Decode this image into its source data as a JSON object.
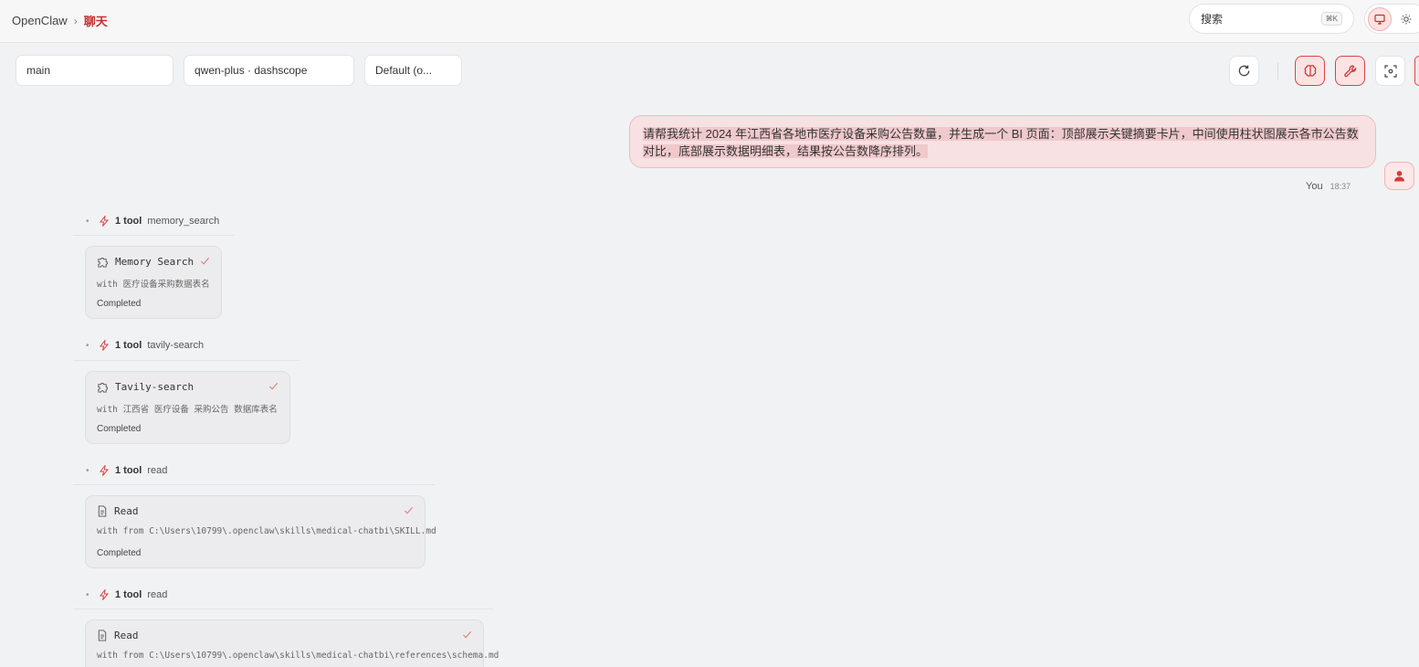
{
  "breadcrumb": {
    "app": "OpenClaw",
    "separator": "›",
    "current": "聊天"
  },
  "search": {
    "placeholder": "搜索",
    "shortcut": "⌘K"
  },
  "controls": {
    "session": "main",
    "model": "qwen-plus · dashscope",
    "thinking": "Default (o..."
  },
  "message": {
    "text": "请帮我统计 2024 年江西省各地市医疗设备采购公告数量，并生成一个 BI 页面：顶部展示关键摘要卡片，中间使用柱状图展示各市公告数对比，底部展示数据明细表，结果按公告数降序排列。",
    "author": "You",
    "time": "18:37"
  },
  "tool_groups": [
    {
      "count": "1 tool",
      "name": "memory_search",
      "card_title": "Memory Search",
      "args": "with 医疗设备采购数据表名",
      "status": "Completed",
      "icon": "puzzle-icon"
    },
    {
      "count": "1 tool",
      "name": "tavily-search",
      "card_title": "Tavily-search",
      "args": "with 江西省 医疗设备 采购公告 数据库表名",
      "status": "Completed",
      "icon": "puzzle-icon"
    },
    {
      "count": "1 tool",
      "name": "read",
      "card_title": "Read",
      "args": "with from C:\\Users\\10799\\.openclaw\\skills\\medical-chatbi\\SKILL.md",
      "status": "Completed",
      "icon": "file-icon"
    },
    {
      "count": "1 tool",
      "name": "read",
      "card_title": "Read",
      "args": "with from C:\\Users\\10799\\.openclaw\\skills\\medical-chatbi\\references\\schema.md",
      "status": "",
      "icon": "file-icon"
    }
  ],
  "colors": {
    "accent": "#c62f2f",
    "bubble": "#f8e1e2",
    "background": "#f1f2f4"
  }
}
